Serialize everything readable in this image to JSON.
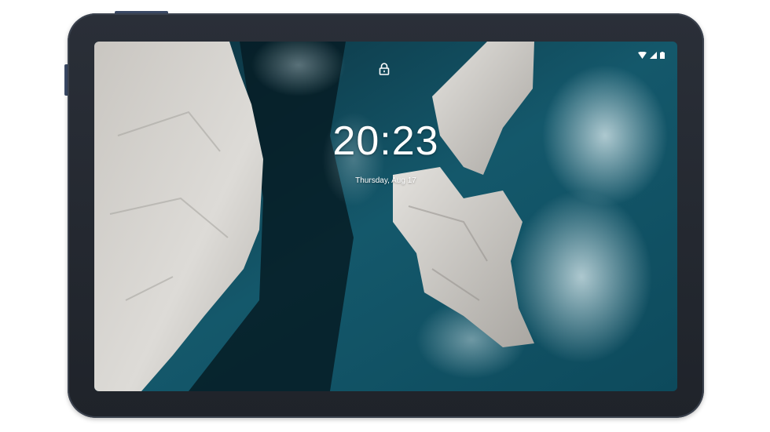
{
  "lockscreen": {
    "time": "20:23",
    "date": "Thursday, Aug 17"
  },
  "status_bar": {
    "icons": [
      "wifi-icon",
      "cellular-signal-icon",
      "battery-icon"
    ]
  },
  "icons": {
    "lock": "lock-icon"
  },
  "colors": {
    "device_frame": "#1f232a",
    "device_accent_button": "#3b4b68",
    "ocean": "#0e3c4d",
    "rock": "#d8d6d2",
    "text": "#ffffff"
  }
}
